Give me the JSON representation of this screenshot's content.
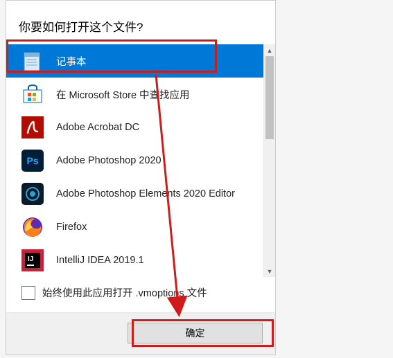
{
  "dialog": {
    "title": "你要如何打开这个文件?",
    "apps": [
      {
        "name": "记事本",
        "icon": "notepad",
        "selected": true
      },
      {
        "name": "在 Microsoft Store 中查找应用",
        "icon": "store",
        "selected": false
      },
      {
        "name": "Adobe Acrobat DC",
        "icon": "acrobat",
        "selected": false
      },
      {
        "name": "Adobe Photoshop 2020",
        "icon": "photoshop",
        "selected": false
      },
      {
        "name": "Adobe Photoshop Elements 2020 Editor",
        "icon": "pse",
        "selected": false
      },
      {
        "name": "Firefox",
        "icon": "firefox",
        "selected": false
      },
      {
        "name": "IntelliJ IDEA 2019.1",
        "icon": "intellij",
        "selected": false
      }
    ],
    "always_use_label": "始终使用此应用打开 .vmoptions 文件",
    "ok_label": "确定"
  }
}
